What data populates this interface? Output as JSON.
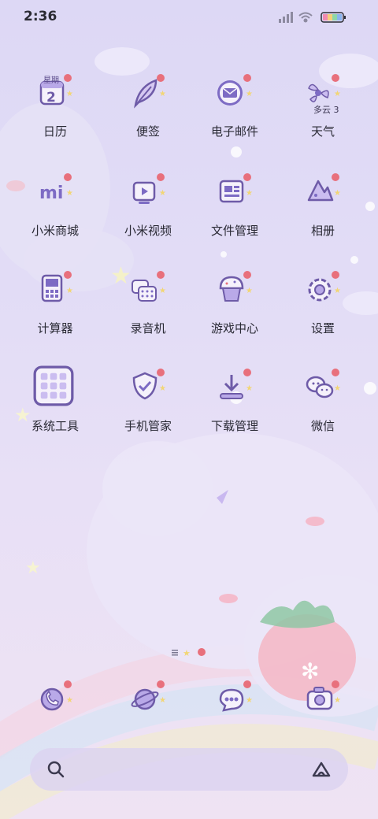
{
  "status_bar": {
    "time": "2:36",
    "icons": [
      "signal-icon",
      "wifi-icon",
      "battery-icon"
    ]
  },
  "theme": {
    "accent": "#7d6bc4",
    "icon_fill": "#f5f1fb",
    "strawberry": "#e8707c"
  },
  "apps": [
    {
      "label": "日历",
      "icon": "calendar-icon",
      "badge": "星期"
    },
    {
      "label": "便签",
      "icon": "feather-icon"
    },
    {
      "label": "电子邮件",
      "icon": "mail-icon"
    },
    {
      "label": "天气",
      "icon": "weather-icon",
      "badge": "多云 3"
    },
    {
      "label": "小米商城",
      "icon": "mi-logo-icon"
    },
    {
      "label": "小米视频",
      "icon": "video-icon"
    },
    {
      "label": "文件管理",
      "icon": "folder-icon"
    },
    {
      "label": "相册",
      "icon": "gallery-icon"
    },
    {
      "label": "计算器",
      "icon": "calculator-icon"
    },
    {
      "label": "录音机",
      "icon": "recorder-icon"
    },
    {
      "label": "游戏中心",
      "icon": "game-cupcake-icon"
    },
    {
      "label": "设置",
      "icon": "gear-icon"
    },
    {
      "label": "系统工具",
      "icon": "folder-grid-icon"
    },
    {
      "label": "手机管家",
      "icon": "shield-icon"
    },
    {
      "label": "下载管理",
      "icon": "download-icon"
    },
    {
      "label": "微信",
      "icon": "wechat-icon"
    }
  ],
  "dock": [
    "phone-icon",
    "browser-planet-icon",
    "messages-icon",
    "camera-icon"
  ],
  "search_bar": {
    "icons": [
      "search-icon",
      "ai-assistant-icon"
    ]
  }
}
